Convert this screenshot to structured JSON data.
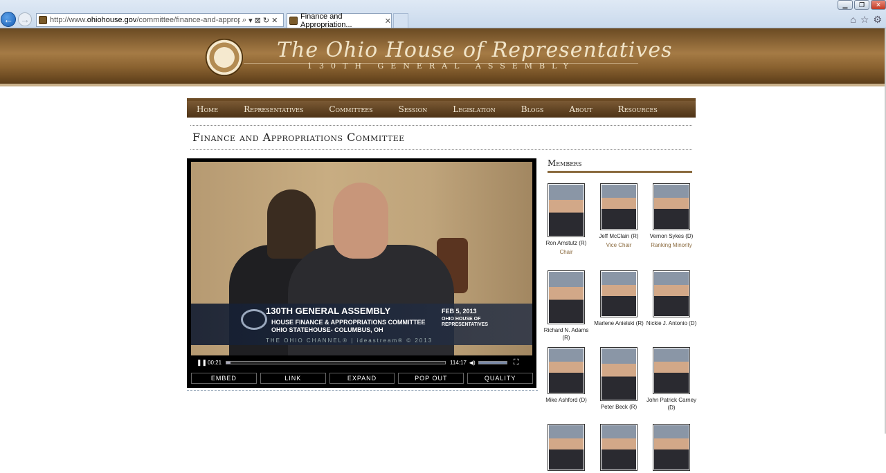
{
  "browser": {
    "url_prefix": "http://www.",
    "url_domain": "ohiohouse.gov",
    "url_path": "/committee/finance-and-appropriation",
    "address_icons": [
      "⌕",
      "▾",
      "⊠",
      "↻",
      "✕"
    ],
    "tab_title": "Finance and Appropriation...",
    "tab_close": "✕",
    "window_buttons": [
      "▁",
      "❐",
      "✕"
    ],
    "tools": [
      "⌂",
      "☆",
      "⚙"
    ]
  },
  "header": {
    "title": "The Ohio House of Representatives",
    "subtitle": "130TH GENERAL ASSEMBLY"
  },
  "nav": {
    "items": [
      "Home",
      "Representatives",
      "Committees",
      "Session",
      "Legislation",
      "Blogs",
      "About",
      "Resources"
    ]
  },
  "page": {
    "title": "Finance and Appropriations Committee"
  },
  "video": {
    "overlay_title": "130TH GENERAL ASSEMBLY",
    "overlay_line1": "HOUSE FINANCE & APPROPRIATIONS COMMITTEE",
    "overlay_line2": "OHIO STATEHOUSE- COLUMBUS, OH",
    "overlay_date": "FEB 5, 2013",
    "overlay_org": "OHIO HOUSE OF REPRESENTATIVES",
    "overlay_channel": "THE OHIO CHANNEL® | ideastream® © 2013",
    "current_time": "00:21",
    "duration": "114:17",
    "progress_fraction": 0.005,
    "play_glyph": "❚❚",
    "volume_glyph": "◀)",
    "fullscreen_glyph": "⛶",
    "buttons": [
      "EMBED",
      "LINK",
      "EXPAND",
      "POP OUT",
      "QUALITY"
    ]
  },
  "members": {
    "title": "Members",
    "list": [
      {
        "name": "Ron Amstutz (R)",
        "role": "Chair"
      },
      {
        "name": "Jeff McClain (R)",
        "role": "Vice Chair"
      },
      {
        "name": "Vernon Sykes (D)",
        "role": "Ranking Minority"
      },
      {
        "name": "Richard N. Adams (R)",
        "role": ""
      },
      {
        "name": "Marlene Anielski (R)",
        "role": ""
      },
      {
        "name": "Nickie J. Antonio (D)",
        "role": ""
      },
      {
        "name": "Mike Ashford (D)",
        "role": ""
      },
      {
        "name": "Peter Beck (R)",
        "role": ""
      },
      {
        "name": "John Patrick Carney (D)",
        "role": ""
      }
    ]
  }
}
